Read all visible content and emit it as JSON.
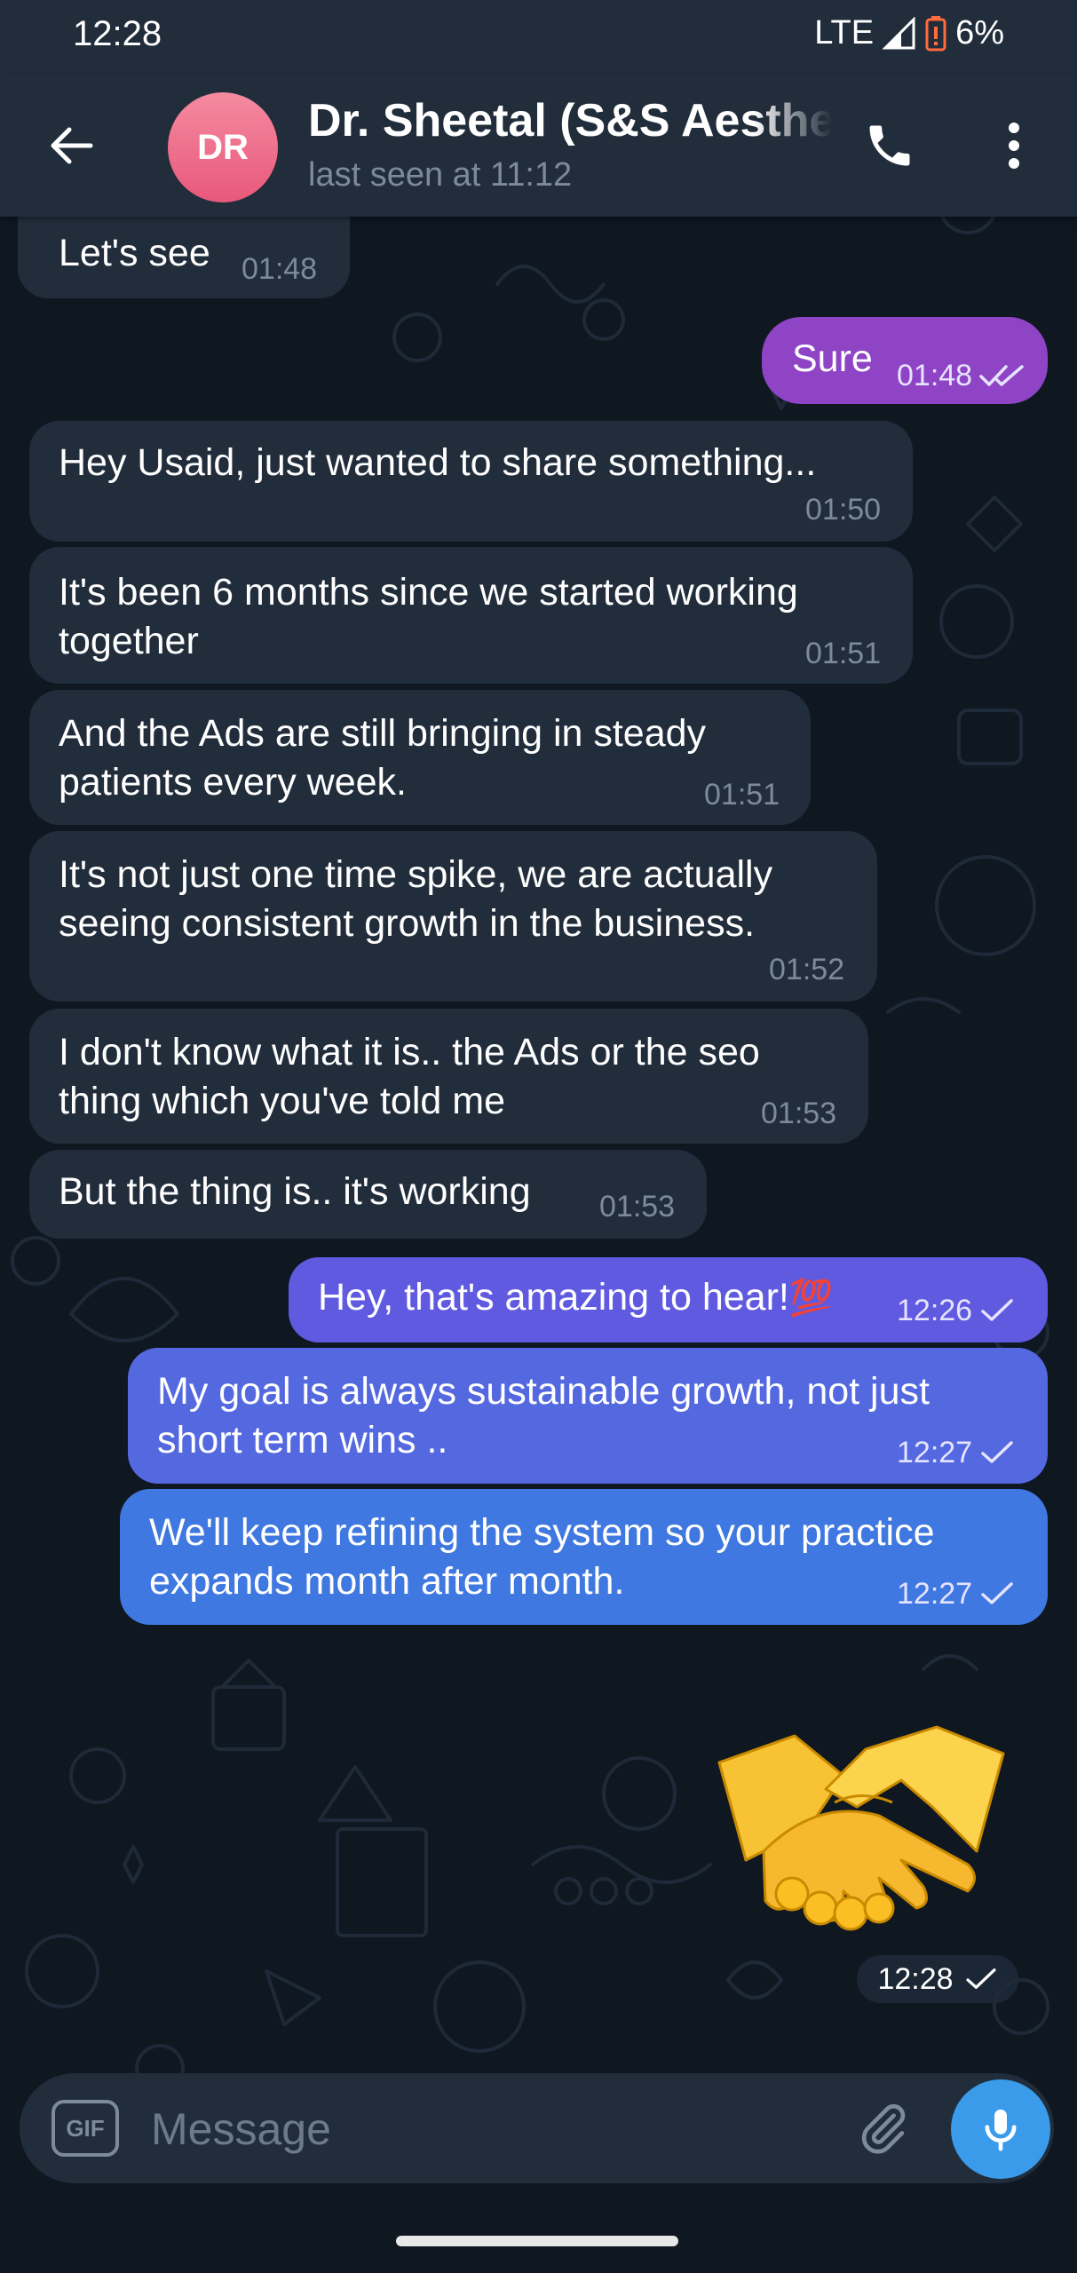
{
  "status_bar": {
    "time": "12:28",
    "network": "LTE",
    "battery": "6%"
  },
  "header": {
    "avatar_initials": "DR",
    "contact_name": "Dr. Sheetal (S&S Aesthetics)",
    "last_seen": "last seen at 11:12"
  },
  "messages": [
    {
      "direction": "in",
      "text": "Let's see",
      "time": "01:48"
    },
    {
      "direction": "out",
      "text": "Sure",
      "time": "01:48",
      "status": "read"
    },
    {
      "direction": "in",
      "text": "Hey Usaid, just wanted to share something...",
      "time": "01:50"
    },
    {
      "direction": "in",
      "text_lines": [
        "It's been 6 months since we started working",
        "together"
      ],
      "time": "01:51"
    },
    {
      "direction": "in",
      "text_lines": [
        "And the Ads are still bringing in steady",
        "patients every week."
      ],
      "time": "01:51"
    },
    {
      "direction": "in",
      "text_lines": [
        "It's not just one time spike, we are actually",
        "seeing consistent growth in the business."
      ],
      "time": "01:52"
    },
    {
      "direction": "in",
      "text_lines": [
        "I don't know what it is.. the Ads or the seo",
        "thing which you've told me"
      ],
      "time": "01:53"
    },
    {
      "direction": "in",
      "text": "But the thing is.. it's working",
      "time": "01:53"
    },
    {
      "direction": "out",
      "text": "Hey, that's amazing to hear!",
      "emoji": "💯",
      "time": "12:26",
      "status": "sent"
    },
    {
      "direction": "out",
      "text_lines": [
        "My goal is always sustainable growth, not just",
        "short term wins .."
      ],
      "time": "12:27",
      "status": "sent"
    },
    {
      "direction": "out",
      "text_lines": [
        "We'll keep refining the system so your practice",
        "expands month after month."
      ],
      "time": "12:27",
      "status": "sent"
    },
    {
      "direction": "out",
      "sticker": "handshake",
      "time": "12:28",
      "status": "sent"
    }
  ],
  "input": {
    "gif_label": "GIF",
    "placeholder": "Message"
  },
  "icons": {
    "back": "arrow-left-icon",
    "call": "phone-icon",
    "menu": "more-vertical-icon",
    "attach": "paperclip-icon",
    "mic": "microphone-icon",
    "read": "double-check-icon",
    "sent": "check-icon",
    "sticker": "handshake-icon"
  },
  "colors": {
    "header_bg": "#212d3b",
    "chat_bg": "#0f1721",
    "incoming_bubble": "#212d3b",
    "outgoing_purple": "#8e44c4",
    "outgoing_violet": "#5f5ae0",
    "outgoing_blue": "#3f78e0",
    "accent": "#3a9bea",
    "avatar": "#e8587a"
  }
}
